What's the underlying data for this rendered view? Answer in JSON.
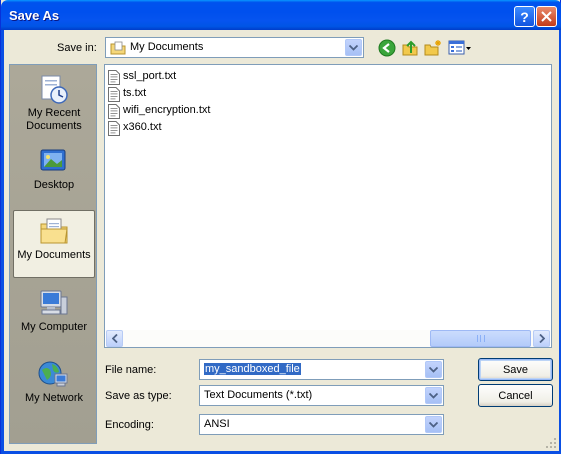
{
  "window": {
    "title": "Save As"
  },
  "toolbar": {
    "save_in_label": "Save in:",
    "save_in_value": "My Documents"
  },
  "places": [
    {
      "label_line1": "My Recent",
      "label_line2": "Documents",
      "icon": "recent-documents-icon"
    },
    {
      "label_line1": "Desktop",
      "label_line2": "",
      "icon": "desktop-icon"
    },
    {
      "label_line1": "My Documents",
      "label_line2": "",
      "icon": "my-documents-folder-icon",
      "selected": true
    },
    {
      "label_line1": "My Computer",
      "label_line2": "",
      "icon": "my-computer-icon"
    },
    {
      "label_line1": "My Network",
      "label_line2": "",
      "icon": "my-network-icon"
    }
  ],
  "files": [
    {
      "name": "ssl_port.txt"
    },
    {
      "name": "ts.txt"
    },
    {
      "name": "wifi_encryption.txt"
    },
    {
      "name": "x360.txt"
    }
  ],
  "form": {
    "file_name_label": "File name:",
    "file_name_value": "my_sandboxed_file",
    "save_as_type_label": "Save as type:",
    "save_as_type_value": "Text Documents (*.txt)",
    "encoding_label": "Encoding:",
    "encoding_value": "ANSI"
  },
  "buttons": {
    "save": "Save",
    "cancel": "Cancel"
  },
  "colors": {
    "titlebar": "#0054e3",
    "dialog_bg": "#ece9d8",
    "selection": "#316ac5"
  }
}
